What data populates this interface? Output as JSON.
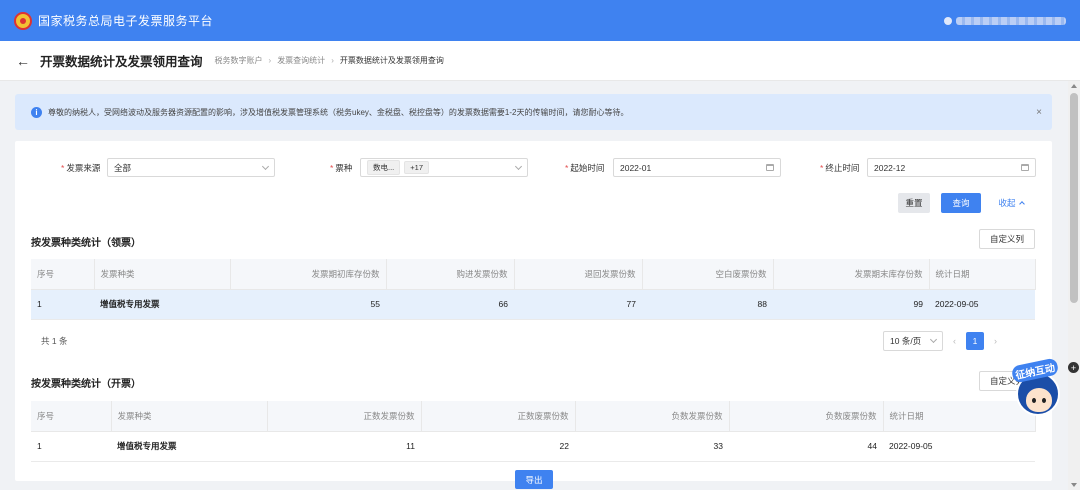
{
  "app": {
    "title": "国家税务总局电子发票服务平台"
  },
  "page": {
    "title": "开票数据统计及发票领用查询",
    "breadcrumbs": [
      "税务数字账户",
      "发票查询统计",
      "开票数据统计及发票领用查询"
    ]
  },
  "notice": {
    "text": "尊敬的纳税人，受网络波动及服务器资源配置的影响，涉及增值税发票管理系统（税务ukey、金税盘、税控盘等）的发票数据需要1-2天的传输时间，请您耐心等待。",
    "close": "×"
  },
  "filters": {
    "source": {
      "label": "发票来源",
      "value": "全部"
    },
    "type": {
      "label": "票种",
      "tag": "数电...",
      "more": "+17"
    },
    "start": {
      "label": "起始时间",
      "value": "2022-01"
    },
    "end": {
      "label": "终止时间",
      "value": "2022-12"
    }
  },
  "actions": {
    "reset": "重置",
    "query": "查询",
    "collapse": "收起",
    "export": "导出"
  },
  "section1": {
    "title": "按发票种类统计（领票）",
    "custom_col": "自定义列",
    "headers": [
      "序号",
      "发票种类",
      "发票期初库存份数",
      "购进发票份数",
      "退回发票份数",
      "空白废票份数",
      "发票期末库存份数",
      "统计日期"
    ],
    "rows": [
      [
        "1",
        "增值税专用发票",
        "55",
        "66",
        "77",
        "88",
        "99",
        "2022-09-05"
      ]
    ],
    "total": "共 1 条",
    "page_size": "10 条/页",
    "current_page": "1"
  },
  "section2": {
    "title": "按发票种类统计（开票）",
    "custom_col": "自定义列",
    "headers": [
      "序号",
      "发票种类",
      "正数发票份数",
      "正数废票份数",
      "负数发票份数",
      "负数废票份数",
      "统计日期"
    ],
    "rows": [
      [
        "1",
        "增值税专用发票",
        "11",
        "22",
        "33",
        "44",
        "2022-09-05"
      ]
    ]
  },
  "assistant": {
    "label": "征纳互动"
  },
  "colors": {
    "primary": "#3f82f0",
    "notice_bg": "#dbe9fd",
    "selected_row": "#e6f0fc"
  }
}
